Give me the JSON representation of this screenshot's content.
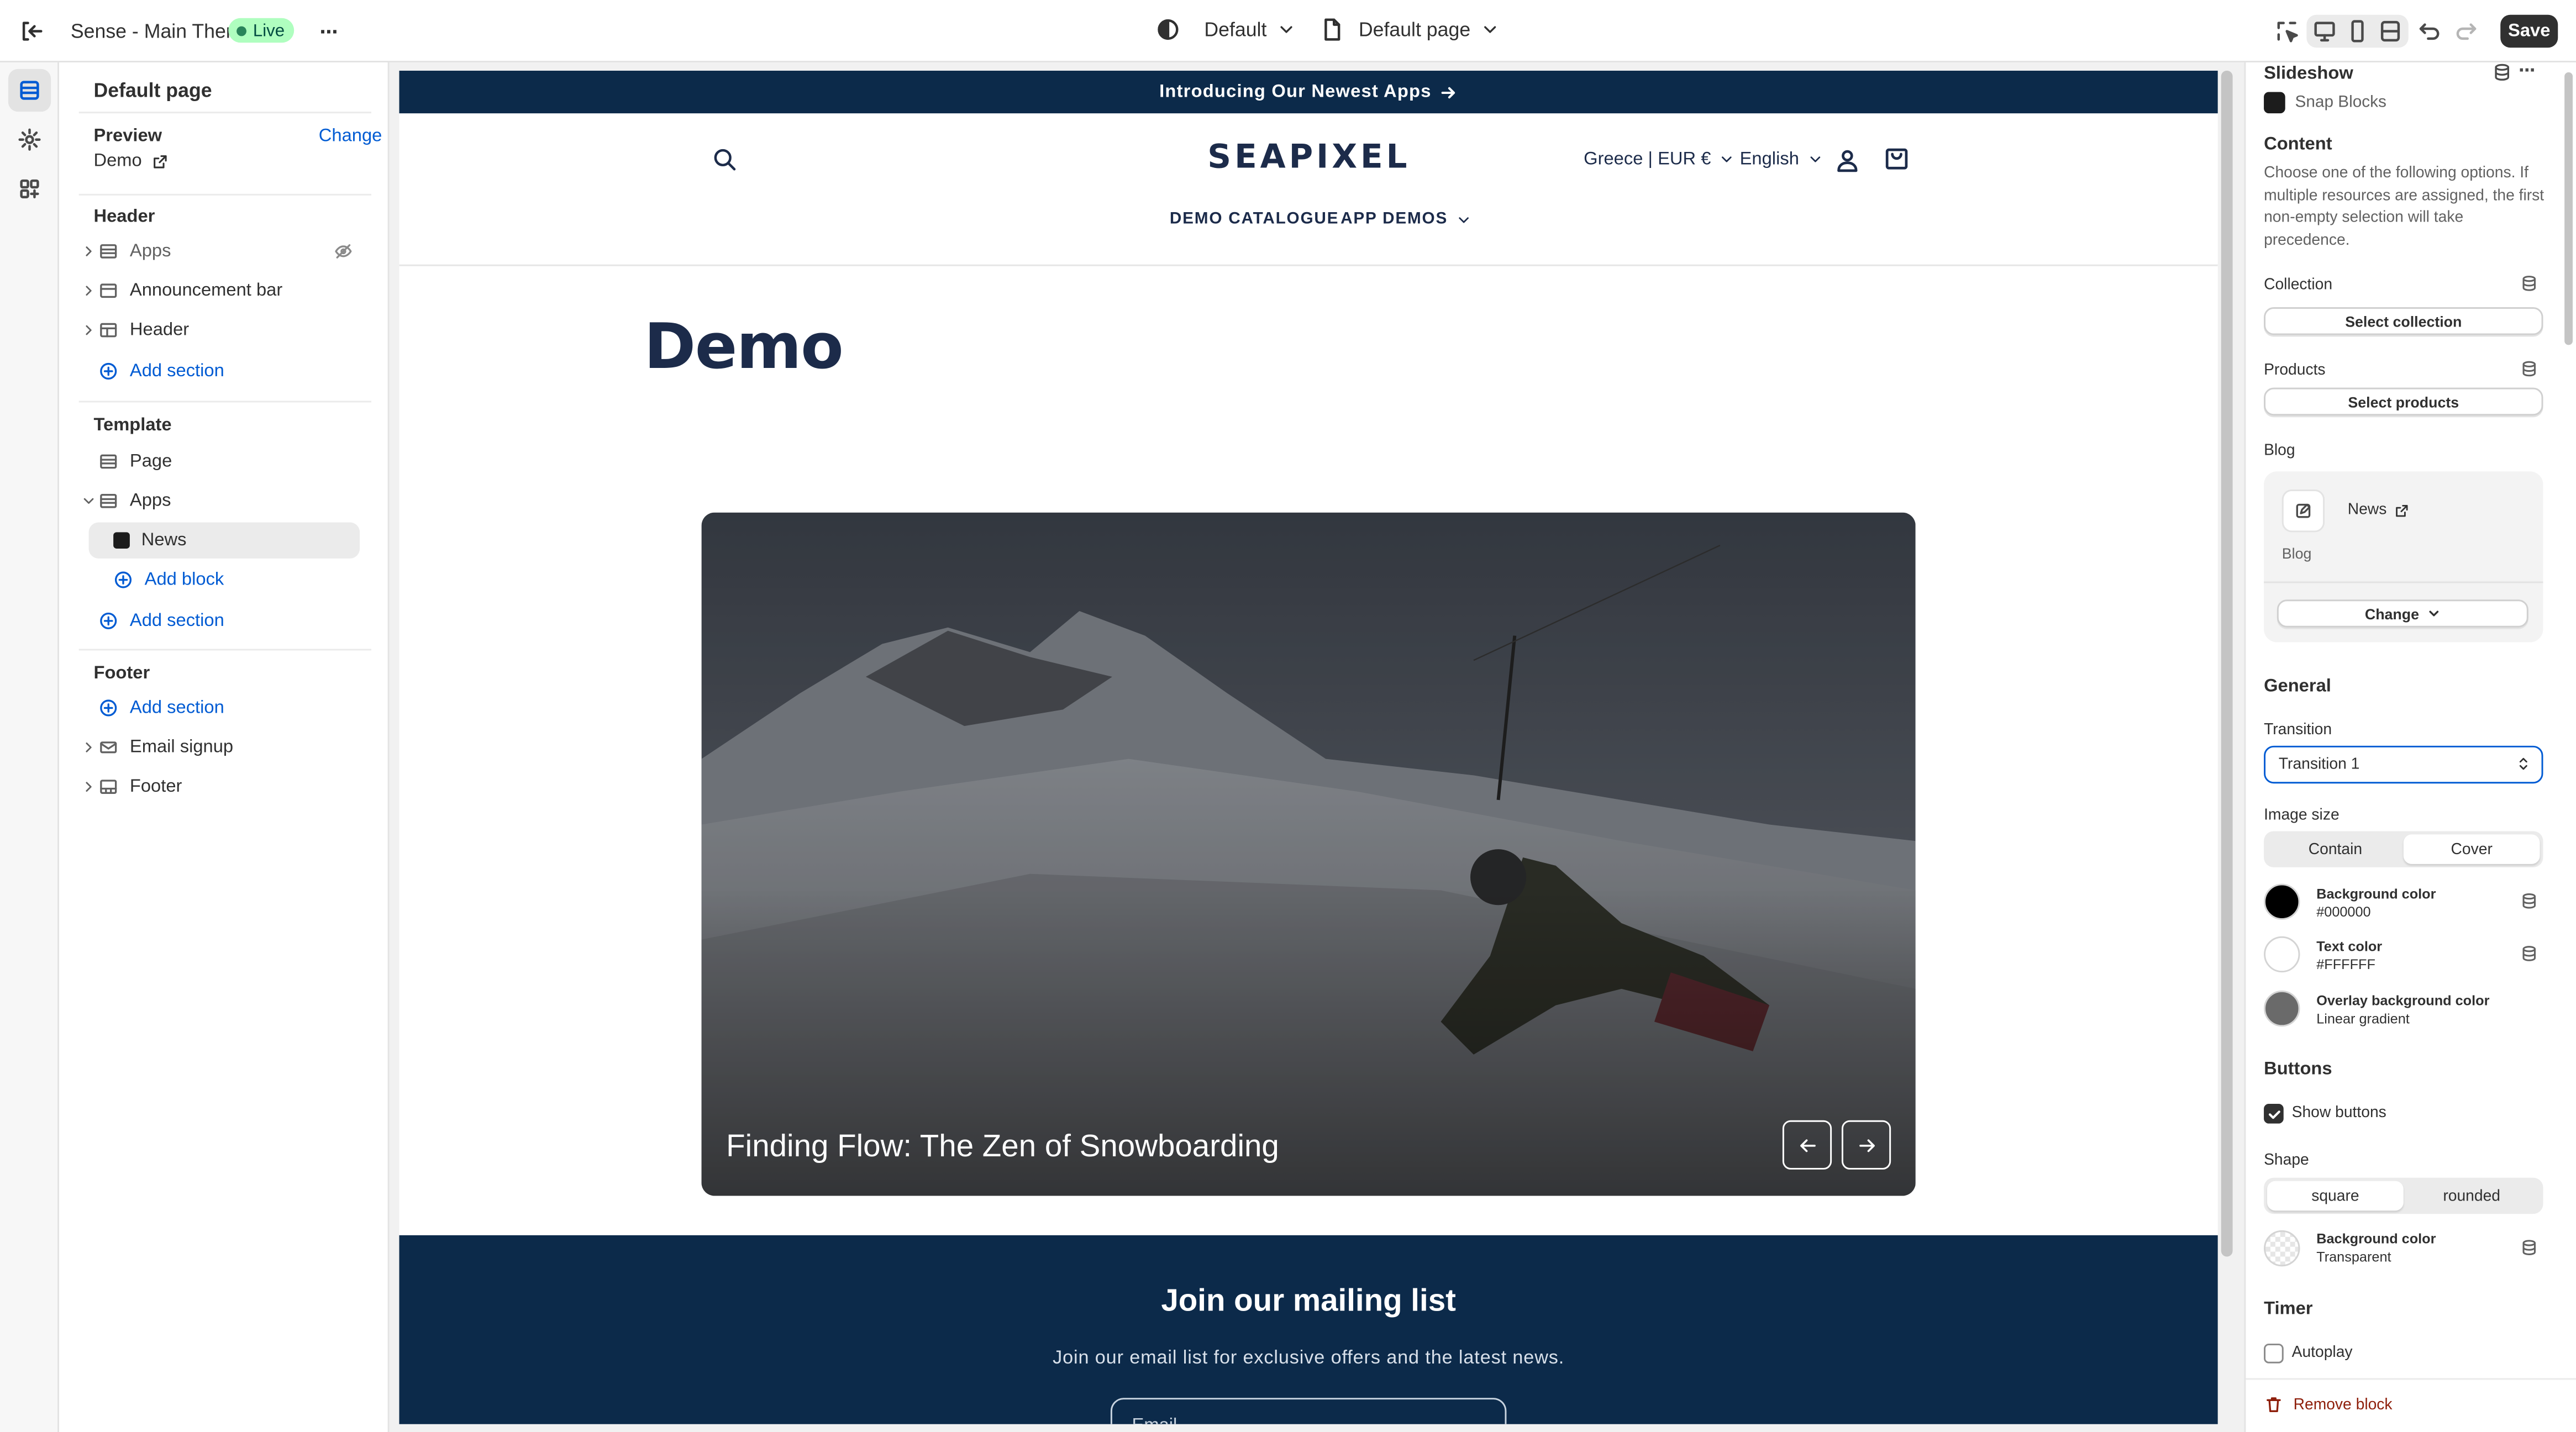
{
  "colors": {
    "accent": "#005bd3",
    "live_bg": "#affebf",
    "save_bg": "#303030",
    "store_navy": "#0c2a4a",
    "danger": "#8e1f0b"
  },
  "topbar": {
    "theme_name": "Sense - Main Theme",
    "live_badge": "Live",
    "theme_selector": "Default",
    "template_selector": "Default page",
    "save_label": "Save"
  },
  "rail": {
    "items": [
      {
        "icon": "sections-icon",
        "active": true
      },
      {
        "icon": "gear-icon",
        "active": false
      },
      {
        "icon": "apps-icon",
        "active": false
      }
    ]
  },
  "sidebar": {
    "title": "Default page",
    "preview_label": "Preview",
    "preview_change": "Change",
    "preview_value": "Demo",
    "header_group": {
      "label": "Header",
      "items": [
        "Apps",
        "Announcement bar",
        "Header"
      ],
      "add_section": "Add section"
    },
    "template_group": {
      "label": "Template",
      "page_item": "Page",
      "apps_item": "Apps",
      "news_block": "News",
      "add_block": "Add block",
      "add_section": "Add section"
    },
    "footer_group": {
      "label": "Footer",
      "add_section": "Add section",
      "items": [
        "Email signup",
        "Footer"
      ]
    }
  },
  "preview": {
    "announcement": "Introducing Our Newest Apps",
    "logo": "SEAPIXEL",
    "locale": "Greece | EUR €",
    "language": "English",
    "nav": [
      "DEMO CATALOGUE",
      "APP DEMOS"
    ],
    "page_title": "Demo",
    "slide_title": "Finding Flow: The Zen of Snowboarding",
    "newsletter_title": "Join our mailing list",
    "newsletter_sub": "Join our email list for exclusive offers and the latest news.",
    "email_placeholder": "Email"
  },
  "settings": {
    "block_title": "Slideshow",
    "app_name": "Snap Blocks",
    "content_heading": "Content",
    "content_desc": "Choose one of the following options. If multiple resources are assigned, the first non-empty selection will take precedence.",
    "collection_label": "Collection",
    "collection_btn": "Select collection",
    "products_label": "Products",
    "products_btn": "Select products",
    "blog_label": "Blog",
    "blog_name": "News",
    "blog_type": "Blog",
    "blog_change": "Change",
    "general_heading": "General",
    "transition_label": "Transition",
    "transition_value": "Transition 1",
    "image_size_label": "Image size",
    "image_size_options": [
      "Contain",
      "Cover"
    ],
    "image_size_selected": "Cover",
    "bg_color_title": "Background color",
    "bg_color_value": "#000000",
    "text_color_title": "Text color",
    "text_color_value": "#FFFFFF",
    "overlay_title": "Overlay background color",
    "overlay_value": "Linear gradient",
    "buttons_heading": "Buttons",
    "show_buttons_label": "Show buttons",
    "show_buttons_checked": true,
    "shape_label": "Shape",
    "shape_options": [
      "square",
      "rounded"
    ],
    "shape_selected": "square",
    "btn_bg_title": "Background color",
    "btn_bg_value": "Transparent",
    "timer_heading": "Timer",
    "autoplay_label": "Autoplay",
    "autoplay_checked": false,
    "remove_block": "Remove block"
  }
}
